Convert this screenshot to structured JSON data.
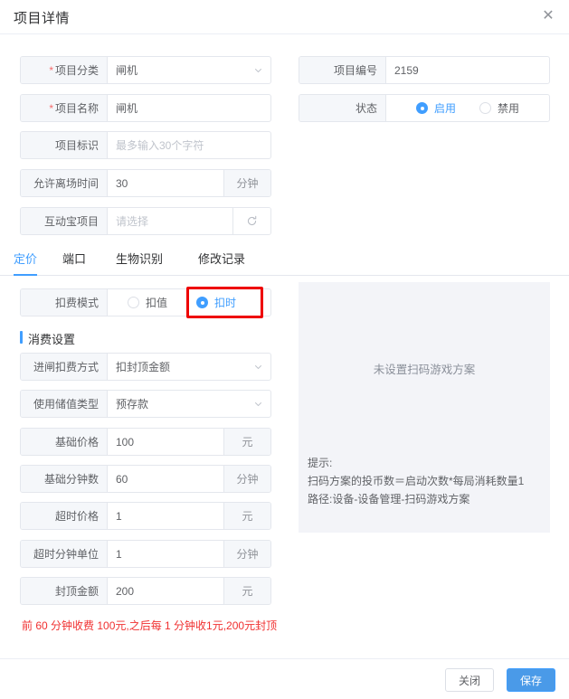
{
  "dialog": {
    "title": "项目详情",
    "close_icon": "close-icon"
  },
  "basic_form": {
    "left": [
      {
        "label": "项目分类",
        "required": true,
        "value": "闸机",
        "placeholder": "",
        "type": "select",
        "unit": ""
      },
      {
        "label": "项目名称",
        "required": true,
        "value": "闸机",
        "placeholder": "",
        "type": "text",
        "unit": ""
      },
      {
        "label": "项目标识",
        "required": false,
        "value": "",
        "placeholder": "最多输入30个字符",
        "type": "text",
        "unit": ""
      },
      {
        "label": "允许离场时间",
        "required": false,
        "value": "30",
        "placeholder": "",
        "type": "text",
        "unit": "分钟"
      },
      {
        "label": "互动宝项目",
        "required": false,
        "value": "",
        "placeholder": "请选择",
        "type": "select-refresh",
        "unit": ""
      }
    ],
    "right": [
      {
        "label": "项目编号",
        "required": false,
        "value": "2159",
        "placeholder": "",
        "type": "text",
        "unit": ""
      }
    ],
    "status": {
      "label": "状态",
      "options": [
        {
          "label": "启用",
          "selected": true
        },
        {
          "label": "禁用",
          "selected": false
        }
      ]
    }
  },
  "tabs": [
    {
      "label": "定价",
      "active": true
    },
    {
      "label": "端口",
      "active": false
    },
    {
      "label": "生物识别",
      "active": false
    },
    {
      "label": "修改记录",
      "active": false
    }
  ],
  "charge_mode": {
    "label": "扣费模式",
    "options": [
      {
        "label": "扣值",
        "selected": false
      },
      {
        "label": "扣时",
        "selected": true
      }
    ],
    "highlight_color": "#ee0000"
  },
  "consume_section": {
    "title": "消费设置",
    "accent_color": "#409eff",
    "fields": [
      {
        "label": "进闸扣费方式",
        "value": "扣封顶金额",
        "placeholder": "",
        "type": "select",
        "unit": ""
      },
      {
        "label": "使用储值类型",
        "value": "预存款",
        "placeholder": "",
        "type": "select",
        "unit": ""
      },
      {
        "label": "基础价格",
        "value": "100",
        "placeholder": "",
        "type": "text",
        "unit": "元"
      },
      {
        "label": "基础分钟数",
        "value": "60",
        "placeholder": "",
        "type": "text",
        "unit": "分钟"
      },
      {
        "label": "超时价格",
        "value": "1",
        "placeholder": "",
        "type": "text",
        "unit": "元"
      },
      {
        "label": "超时分钟单位",
        "value": "1",
        "placeholder": "",
        "type": "text",
        "unit": "分钟"
      },
      {
        "label": "封顶金额",
        "value": "200",
        "placeholder": "",
        "type": "text",
        "unit": "元"
      }
    ],
    "footnote": "前 60 分钟收费 100元,之后每 1 分钟收1元,200元封顶",
    "footnote_color": "#f03030"
  },
  "right_panel": {
    "empty_text": "未设置扫码游戏方案",
    "hint_lines": [
      "提示:",
      "扫码方案的投币数＝启动次数*每局消耗数量1",
      "路径:设备-设备管理-扫码游戏方案"
    ]
  },
  "footer": {
    "close_label": "关闭",
    "save_label": "保存",
    "primary_color": "#4a9ae8"
  }
}
